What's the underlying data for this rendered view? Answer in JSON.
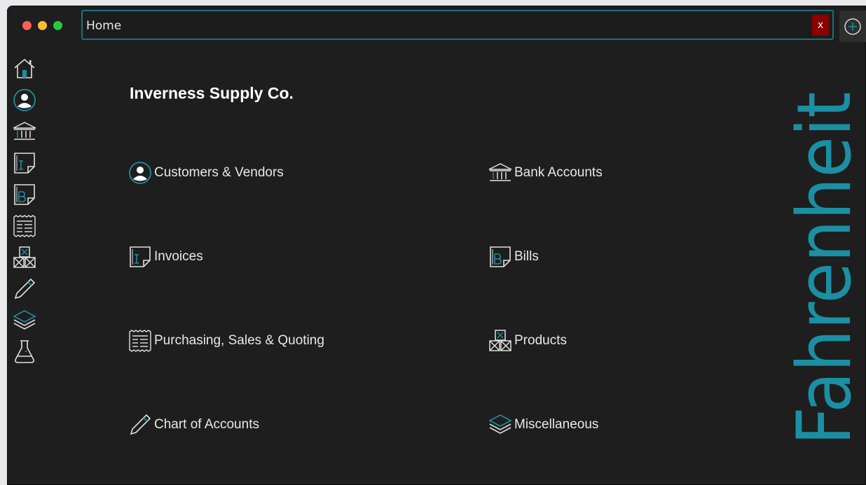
{
  "window": {
    "tab_title": "Home",
    "tab_close_label": "x"
  },
  "home": {
    "company_name": "Inverness Supply Co.",
    "menu": [
      {
        "label": "Customers & Vendors",
        "icon": "user-circle-icon"
      },
      {
        "label": "Bank Accounts",
        "icon": "bank-icon"
      },
      {
        "label": "Invoices",
        "icon": "invoice-icon"
      },
      {
        "label": "Bills",
        "icon": "bill-icon"
      },
      {
        "label": "Purchasing, Sales & Quoting",
        "icon": "receipt-icon"
      },
      {
        "label": "Products",
        "icon": "boxes-icon"
      },
      {
        "label": "Chart of Accounts",
        "icon": "pencil-icon"
      },
      {
        "label": "Miscellaneous",
        "icon": "layers-icon"
      }
    ]
  },
  "sidebar": {
    "icons": [
      "home-icon",
      "user-circle-icon",
      "bank-icon",
      "invoice-icon",
      "bill-icon",
      "receipt-icon",
      "boxes-icon",
      "pencil-icon",
      "layers-icon",
      "flask-icon"
    ]
  },
  "brand": {
    "text": "Fahrenheit",
    "color": "#1b8fa3"
  },
  "colors": {
    "accent": "#1b8fa3",
    "background": "#1e1e1e",
    "close": "#8b0000"
  }
}
